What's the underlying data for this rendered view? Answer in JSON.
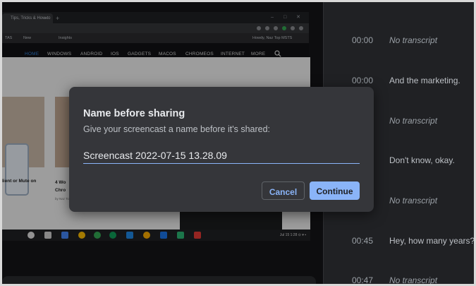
{
  "browser": {
    "tab_title": "Tips, Tricks & How-to",
    "tab_close": "×",
    "new_tab": "+",
    "window_buttons": "– □ ✕",
    "bookmarks": [
      "Apps",
      "TAS",
      "New",
      "Insights",
      "Howdy, Naz Top MSTS"
    ],
    "site_nav": [
      "HOME",
      "WINDOWS",
      "ANDROID",
      "IOS",
      "GADGETS",
      "MACOS",
      "CHROMEOS",
      "INTERNET",
      "MORE"
    ],
    "card1_title": "lient or Mute on",
    "card2_title": "4 Wo\nChro",
    "card2_meta": "by Naz Top | 4 hours ago",
    "shelf_tray": "Jul 15   1:28 ⊙ ▾ ▪"
  },
  "dialog": {
    "title": "Name before sharing",
    "subtitle": "Give your screencast a name before it's shared:",
    "name_value": "Screencast 2022-07-15 13.28.09",
    "cancel_label": "Cancel",
    "continue_label": "Continue"
  },
  "transcript": [
    {
      "time": "00:00",
      "text": "No transcript",
      "empty": true
    },
    {
      "time": "00:00",
      "text": "And the marketing.",
      "empty": false
    },
    {
      "time": "",
      "text": "No transcript",
      "empty": true
    },
    {
      "time": "",
      "text": "Don't know, okay.",
      "empty": false
    },
    {
      "time": "",
      "text": "No transcript",
      "empty": true
    },
    {
      "time": "00:45",
      "text": "Hey, how many years?",
      "empty": false
    },
    {
      "time": "00:47",
      "text": "No transcript",
      "empty": true
    }
  ],
  "colors": {
    "accent": "#8ab4f8",
    "dialog_bg": "#35363a",
    "panel_bg": "#202124"
  }
}
